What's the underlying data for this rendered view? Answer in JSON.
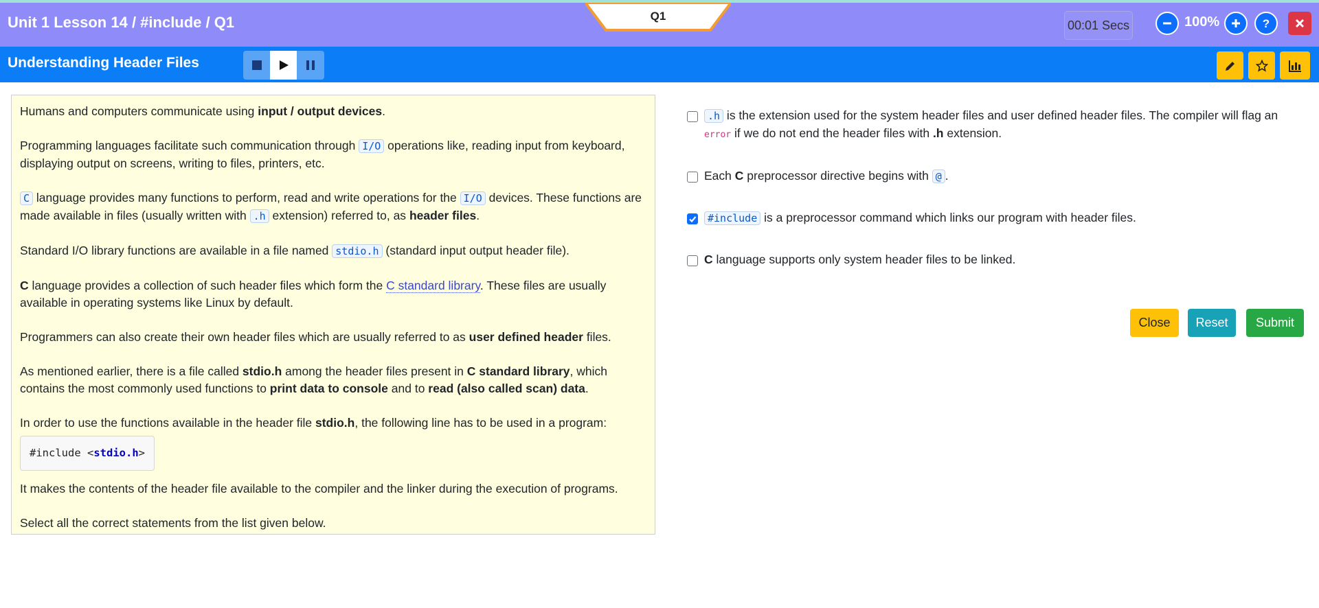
{
  "header": {
    "lesson_title": "Unit 1 Lesson 14 / #include / Q1",
    "question_tab": "Q1",
    "timer": "00:01 Secs",
    "zoom": "100%",
    "icons": [
      "minus-circle-icon",
      "plus-circle-icon",
      "question-circle-icon",
      "close-icon"
    ]
  },
  "subheader": {
    "title": "Understanding Header Files",
    "media_icons": [
      "stop-icon",
      "play-icon",
      "pause-icon"
    ],
    "tool_icons": [
      "pencil-icon",
      "star-icon",
      "bar-chart-icon"
    ]
  },
  "passage": {
    "p1": [
      "Humans and computers communicate using ",
      "input / output devices",
      "."
    ],
    "p2": [
      "Programming languages facilitate such communication through ",
      "I/O",
      " operations like, reading input from keyboard, displaying output on screens, writing to files, printers, etc."
    ],
    "p3": [
      "C",
      " language provides many functions to perform, read and write operations for the ",
      "I/O",
      " devices. These functions are made available in files (usually written with ",
      ".h",
      " extension) referred to, as ",
      "header files",
      "."
    ],
    "p4": [
      "Standard I/O library functions are available in a file named ",
      "stdio.h",
      " (standard input output header file)."
    ],
    "p5": [
      "C",
      " language provides a collection of such header files which form the ",
      "C standard library",
      ". These files are usually available in operating systems like Linux by default."
    ],
    "p6": [
      "Programmers can also create their own header files which are usually referred to as ",
      "user defined header",
      " files."
    ],
    "p7": [
      "As mentioned earlier, there is a file called ",
      "stdio.h",
      " among the header files present in ",
      "C standard library",
      ", which contains the most commonly used functions to ",
      "print data to console",
      " and to ",
      "read (also called scan) data",
      "."
    ],
    "p8": [
      "In order to use the functions available in the header file ",
      "stdio.h",
      ", the following line has to be used in a program:"
    ],
    "code": [
      "#include <",
      "stdio.h",
      ">"
    ],
    "p9": "It makes the contents of the header file available to the compiler and the linker during the execution of programs.",
    "p10": "Select all the correct statements from the list given below."
  },
  "options": [
    {
      "code": ".h",
      "text": " is the extension used for the system header files and user defined header files. The compiler will flag an ",
      "err": "error",
      "text2": " if we do not end the header files with ",
      "bold": ".h",
      "text3": " extension.",
      "checked": false
    },
    {
      "pre": "Each ",
      "bold": "C",
      "text": " preprocessor directive begins with ",
      "code": "@",
      "text2": ".",
      "checked": false
    },
    {
      "code": "#include",
      "text": " is a preprocessor command which links our program with header files.",
      "checked": true
    },
    {
      "bold": "C",
      "text": " language supports only system header files to be linked.",
      "checked": false
    }
  ],
  "buttons": {
    "close": "Close",
    "reset": "Reset",
    "submit": "Submit"
  },
  "colors": {
    "title_bar": "#8f8cf9",
    "sub_bar": "#0b7ef7",
    "passage_bg": "#ffffe0",
    "close_btn": "#ffc107",
    "reset_btn": "#17a2b8",
    "submit_btn": "#28a745",
    "danger": "#dc3545"
  }
}
